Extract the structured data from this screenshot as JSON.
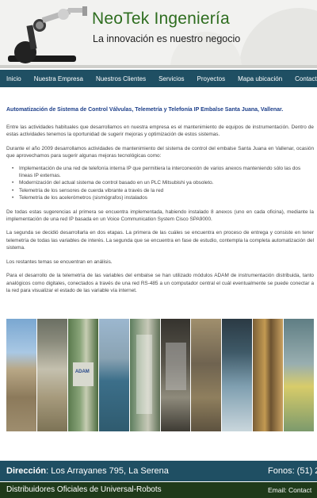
{
  "header": {
    "brand_name": "NeoTek Ingeniería",
    "tagline": "La innovación es nuestro negocio"
  },
  "nav": {
    "items": [
      "Inicio",
      "Nuestra Empresa",
      "Nuestros Clientes",
      "Servicios",
      "Proyectos",
      "Mapa ubicación",
      "Contacto"
    ]
  },
  "article": {
    "title": "Automatización de Sistema de Control Válvulas, Telemetría y Telefonía IP Embalse Santa Juana, Vallenar.",
    "p1": "Entre las actividades habituales que desarrollamos en nuestra empresa es el mantenimiento de equipos de instrumentación. Dentro de estas actividades tenemos la oportunidad de sugerir mejoras y optimización de estos sistemas.",
    "p2": "Durante el año 2009 desarrollamos actividades de mantenimiento del sistema de control del embalse Santa Juana en Vallenar, ocasión que aprovechamos para sugerir algunas mejoras tecnológicas como:",
    "list": [
      "Implementación de una red de telefonía interna IP que permitiera la interconexión de varios anexos manteniendo sólo las dos líneas IP externas.",
      "Modernización del actual sistema de control basado en un PLC Mitsubishi ya obsoleto.",
      "Telemetría de los sensores de cuerda vibrante a través de la red",
      "Telemetría de los acelerómetros (sismógrafos) instalados"
    ],
    "p3": "De todas estas sugerencias al primera se encuentra implementada, habiendo instalado 8 anexos (uno en cada oficina), mediante la implementación de una red IP basada en un Voice Communication System Cisco SPA9000.",
    "p4": "La segunda se decidió desarrollarla en dos etapas. La primera de las cuáles se encuentra en proceso de entrega y consiste en tener telemetría de todas las variables de interés. La segunda que se encuentra en fase de estudio, contempla la completa automatización del sistema.",
    "p5": "Los restantes temas se encuentran en análisis.",
    "p6": "Para el desarrollo de la telemetría de las variables del embalse se han utilizado módulos ADAM de instrumentación distribuida, tanto analógicos como digitales, conectados a través de una red RS-485 a un computador central el cuál eventualmente se puede conectar a la red para visualizar el estado de las variable vía internet."
  },
  "collage": {
    "device_label": "ADAM"
  },
  "footer": {
    "address_label": "Dirección",
    "address_value": ": Los Arrayanes 795, La Serena",
    "phone": "Fonos: (51) 2",
    "distributor": "Distribuidores Oficiales de Universal-Robots",
    "email": "Email: Contact"
  },
  "colors": {
    "nav_bg": "#1f4f63",
    "brand_green": "#2e6d1f",
    "title_blue": "#1d3f8a",
    "footer_dark": "#1f3a1a"
  }
}
